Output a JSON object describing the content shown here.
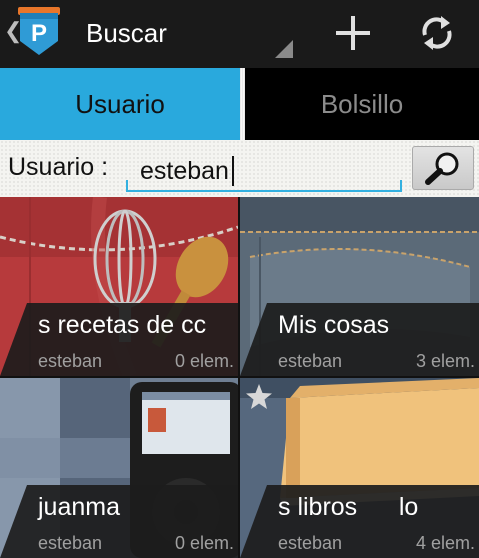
{
  "action_bar": {
    "title": "Buscar",
    "logo_letter": "P",
    "icons": [
      "chevron-left-icon",
      "app-logo-icon",
      "spinner-arrow-icon",
      "add-icon",
      "refresh-icon"
    ]
  },
  "tabs": [
    {
      "label": "Usuario",
      "selected": true
    },
    {
      "label": "Bolsillo",
      "selected": false
    }
  ],
  "search": {
    "label": "Usuario :",
    "value": "esteban",
    "button_icon": "search-icon"
  },
  "collections": [
    {
      "title": "s recetas de cc",
      "owner": "esteban",
      "count": "0 elem."
    },
    {
      "title": "Mis cosas",
      "owner": "esteban",
      "count": "3 elem."
    },
    {
      "title": "juanma",
      "owner": "esteban",
      "count": "0 elem."
    },
    {
      "title": "s libros      lo",
      "owner": "esteban",
      "count": "4 elem.",
      "starred": true
    }
  ],
  "colors": {
    "accent": "#29a9dd",
    "action_bar": "#1a1a1a",
    "tile_info": "#1c1c1c"
  }
}
